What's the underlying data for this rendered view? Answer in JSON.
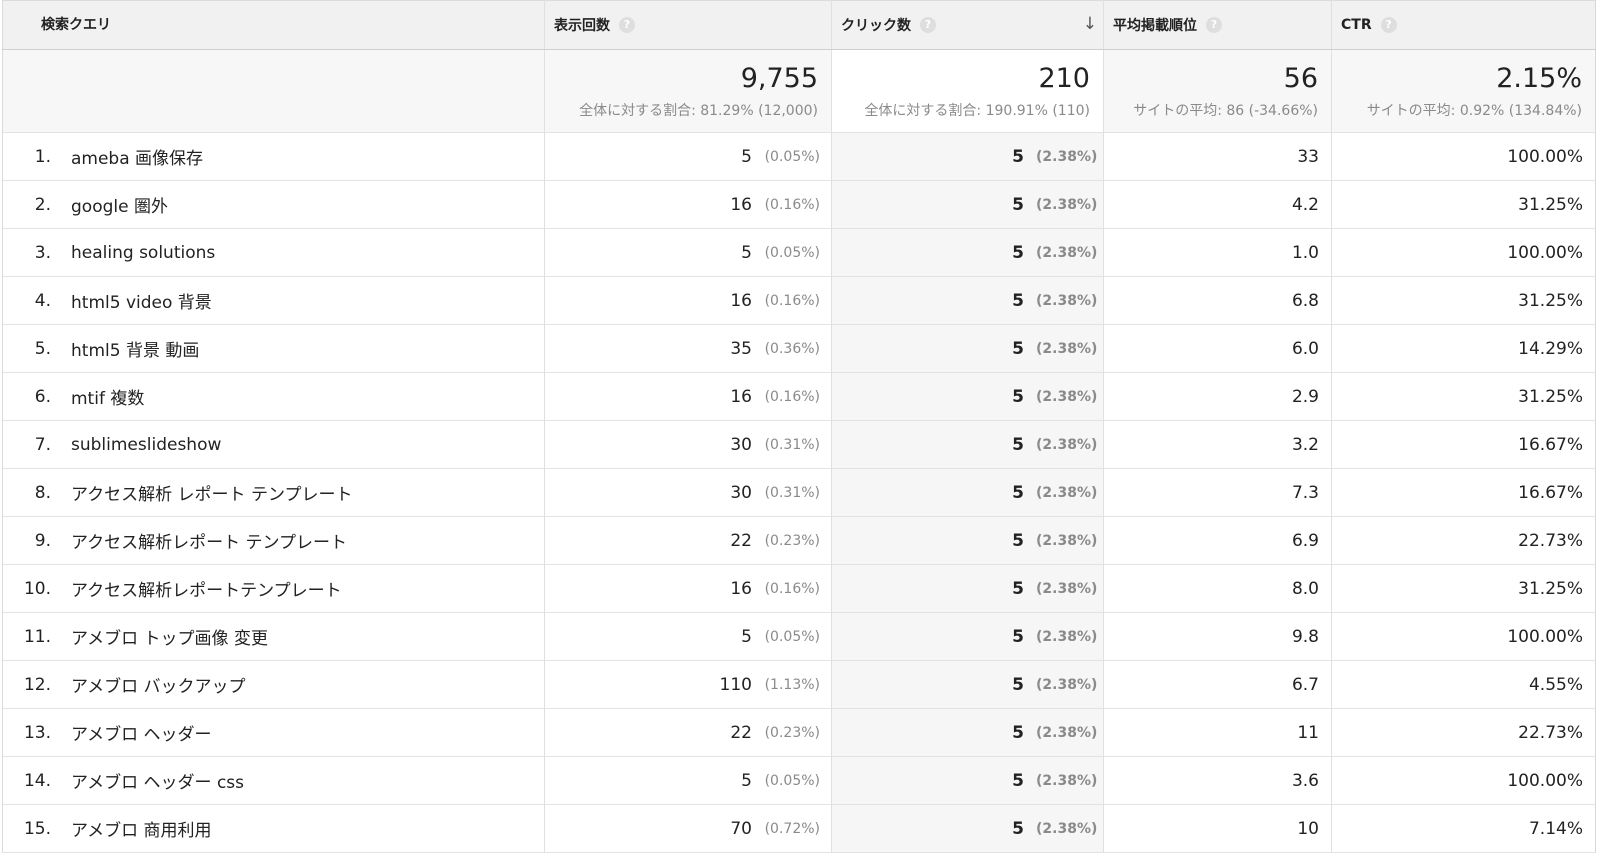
{
  "headers": {
    "query": "検索クエリ",
    "impressions": "表示回数",
    "clicks": "クリック数",
    "avg_position": "平均掲載順位",
    "ctr": "CTR",
    "help_glyph": "?",
    "sort_glyph": "↓"
  },
  "totals": {
    "impressions": {
      "value": "9,755",
      "note": "全体に対する割合: 81.29% (12,000)"
    },
    "clicks": {
      "value": "210",
      "note": "全体に対する割合: 190.91% (110)"
    },
    "avg_position": {
      "value": "56",
      "note": "サイトの平均: 86 (-34.66%)"
    },
    "ctr": {
      "value": "2.15%",
      "note": "サイトの平均: 0.92% (134.84%)"
    }
  },
  "rows": [
    {
      "rank": "1.",
      "query": "ameba 画像保存",
      "impressions": "5",
      "impressions_pct": "(0.05%)",
      "clicks": "5",
      "clicks_pct": "(2.38%)",
      "position": "33",
      "ctr": "100.00%"
    },
    {
      "rank": "2.",
      "query": "google 圏外",
      "impressions": "16",
      "impressions_pct": "(0.16%)",
      "clicks": "5",
      "clicks_pct": "(2.38%)",
      "position": "4.2",
      "ctr": "31.25%"
    },
    {
      "rank": "3.",
      "query": "healing solutions",
      "impressions": "5",
      "impressions_pct": "(0.05%)",
      "clicks": "5",
      "clicks_pct": "(2.38%)",
      "position": "1.0",
      "ctr": "100.00%"
    },
    {
      "rank": "4.",
      "query": "html5 video 背景",
      "impressions": "16",
      "impressions_pct": "(0.16%)",
      "clicks": "5",
      "clicks_pct": "(2.38%)",
      "position": "6.8",
      "ctr": "31.25%"
    },
    {
      "rank": "5.",
      "query": "html5 背景 動画",
      "impressions": "35",
      "impressions_pct": "(0.36%)",
      "clicks": "5",
      "clicks_pct": "(2.38%)",
      "position": "6.0",
      "ctr": "14.29%"
    },
    {
      "rank": "6.",
      "query": "mtif 複数",
      "impressions": "16",
      "impressions_pct": "(0.16%)",
      "clicks": "5",
      "clicks_pct": "(2.38%)",
      "position": "2.9",
      "ctr": "31.25%"
    },
    {
      "rank": "7.",
      "query": "sublimeslideshow",
      "impressions": "30",
      "impressions_pct": "(0.31%)",
      "clicks": "5",
      "clicks_pct": "(2.38%)",
      "position": "3.2",
      "ctr": "16.67%"
    },
    {
      "rank": "8.",
      "query": "アクセス解析 レポート テンプレート",
      "impressions": "30",
      "impressions_pct": "(0.31%)",
      "clicks": "5",
      "clicks_pct": "(2.38%)",
      "position": "7.3",
      "ctr": "16.67%"
    },
    {
      "rank": "9.",
      "query": "アクセス解析レポート テンプレート",
      "impressions": "22",
      "impressions_pct": "(0.23%)",
      "clicks": "5",
      "clicks_pct": "(2.38%)",
      "position": "6.9",
      "ctr": "22.73%"
    },
    {
      "rank": "10.",
      "query": "アクセス解析レポートテンプレート",
      "impressions": "16",
      "impressions_pct": "(0.16%)",
      "clicks": "5",
      "clicks_pct": "(2.38%)",
      "position": "8.0",
      "ctr": "31.25%"
    },
    {
      "rank": "11.",
      "query": "アメブロ トップ画像 変更",
      "impressions": "5",
      "impressions_pct": "(0.05%)",
      "clicks": "5",
      "clicks_pct": "(2.38%)",
      "position": "9.8",
      "ctr": "100.00%"
    },
    {
      "rank": "12.",
      "query": "アメブロ バックアップ",
      "impressions": "110",
      "impressions_pct": "(1.13%)",
      "clicks": "5",
      "clicks_pct": "(2.38%)",
      "position": "6.7",
      "ctr": "4.55%"
    },
    {
      "rank": "13.",
      "query": "アメブロ ヘッダー",
      "impressions": "22",
      "impressions_pct": "(0.23%)",
      "clicks": "5",
      "clicks_pct": "(2.38%)",
      "position": "11",
      "ctr": "22.73%"
    },
    {
      "rank": "14.",
      "query": "アメブロ ヘッダー css",
      "impressions": "5",
      "impressions_pct": "(0.05%)",
      "clicks": "5",
      "clicks_pct": "(2.38%)",
      "position": "3.6",
      "ctr": "100.00%"
    },
    {
      "rank": "15.",
      "query": "アメブロ 商用利用",
      "impressions": "70",
      "impressions_pct": "(0.72%)",
      "clicks": "5",
      "clicks_pct": "(2.38%)",
      "position": "10",
      "ctr": "7.14%"
    }
  ]
}
